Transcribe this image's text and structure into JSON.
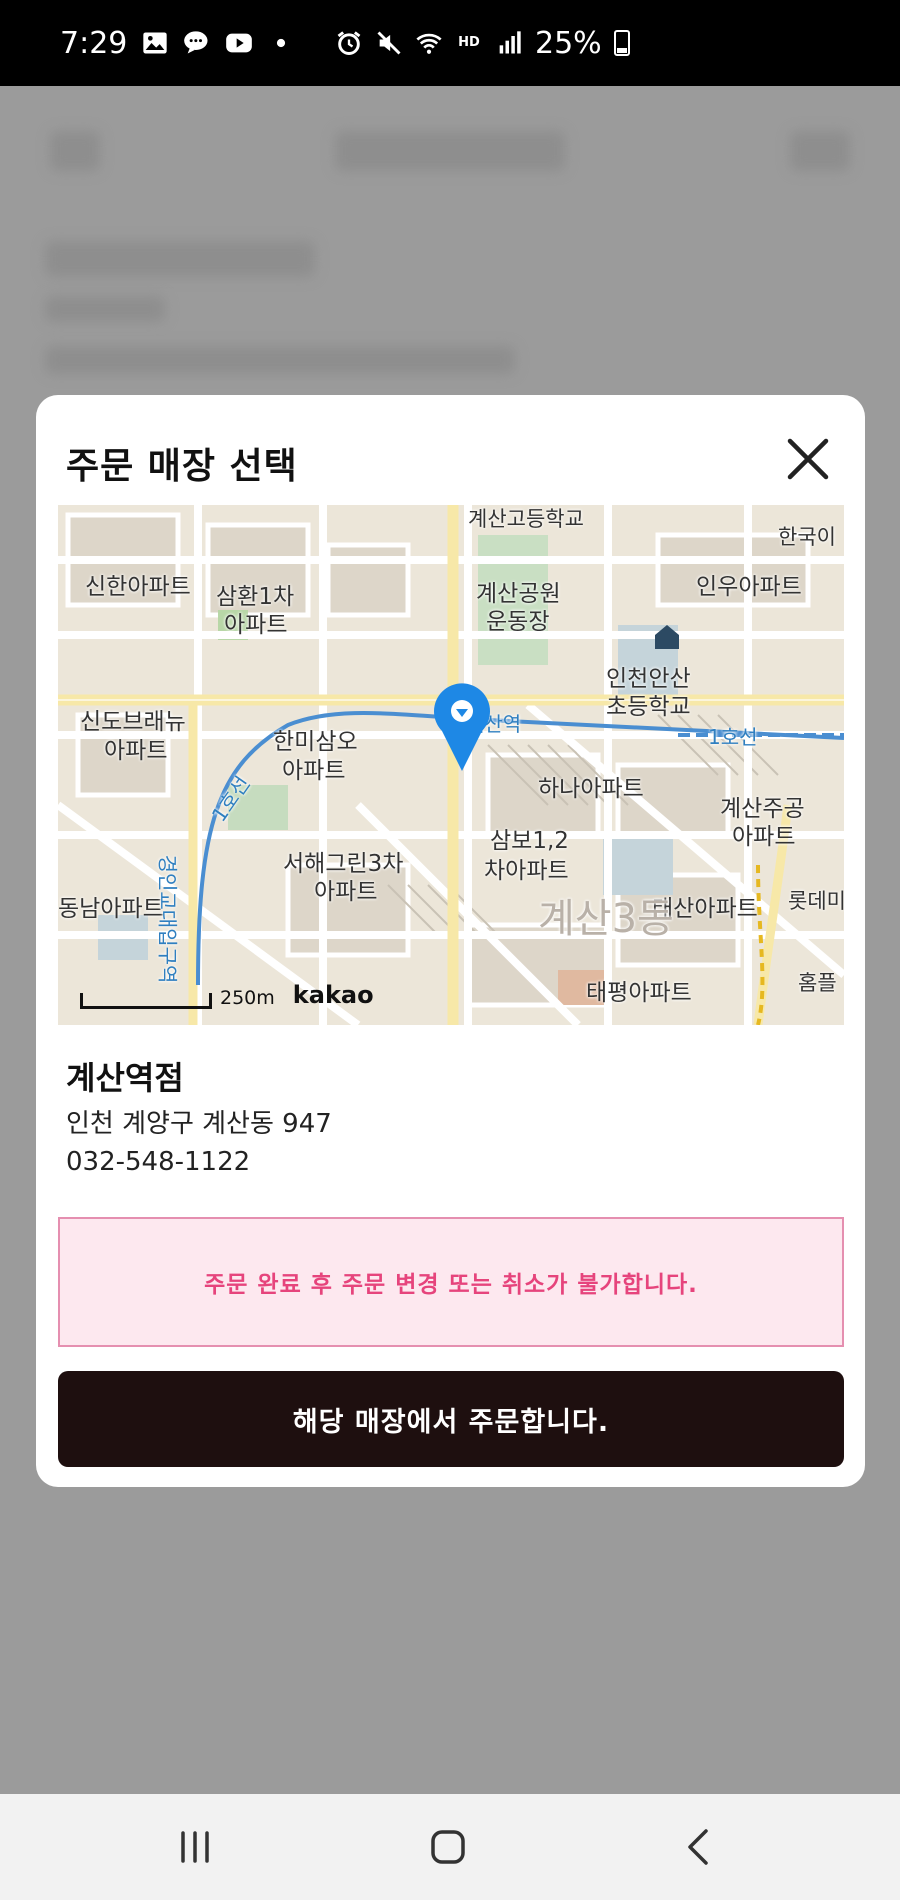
{
  "status_bar": {
    "time": "7:29",
    "battery": "25%",
    "hd_voice": "HD",
    "left_icons": [
      "gallery-icon",
      "chat-icon",
      "youtube-icon",
      "dot-icon"
    ],
    "right_icons": [
      "alarm-icon",
      "mute-icon",
      "wifi-icon",
      "hd-voice-icon",
      "signal-icon",
      "battery-icon"
    ]
  },
  "modal": {
    "title": "주문 매장 선택",
    "close_icon": "close-icon"
  },
  "map": {
    "labels": {
      "school_high": "계산고등학교",
      "korea": "한국이",
      "shinhan_apt": "신한아파트",
      "samhwan": "삼환1차",
      "samhwan_apt": "아파트",
      "park": "계산공원",
      "park_field": "운동장",
      "inu_apt": "인우아파트",
      "elem_1": "인천안산",
      "elem_2": "초등학교",
      "sindo_1": "신도브래뉴",
      "sindo_2": "아파트",
      "station": "계산역",
      "line_1": "1호선",
      "line_1_left": "1호선",
      "hanmi_1": "한미삼오",
      "hanmi_2": "아파트",
      "hana_apt": "하나아파트",
      "gyesan_jugong_1": "계산주공",
      "gyesan_jugong_2": "아파트",
      "sambo_1": "삼보1,2",
      "sambo_2": "차아파트",
      "seohae_1": "서해그린3차",
      "seohae_2": "아파트",
      "lotte": "롯데미",
      "dongnam_apt": "동남아파트",
      "taesan_apt": "태산아파트",
      "district": "계산3동",
      "taepyeong_apt": "태평아파트",
      "homeplus": "홈플",
      "line_vertical": "경인교대입구역"
    },
    "scale": "250m",
    "brand": "kakao",
    "pin_icon": "map-pin-icon"
  },
  "store": {
    "name": "계산역점",
    "address": "인천 계양구 계산동 947",
    "phone": "032-548-1122"
  },
  "notice": "주문 완료 후 주문 변경 또는 취소가 불가합니다.",
  "order_button": "해당 매장에서 주문합니다.",
  "nav_bar": {
    "recents_icon": "recents-icon",
    "home_icon": "home-icon",
    "back_icon": "back-icon"
  }
}
